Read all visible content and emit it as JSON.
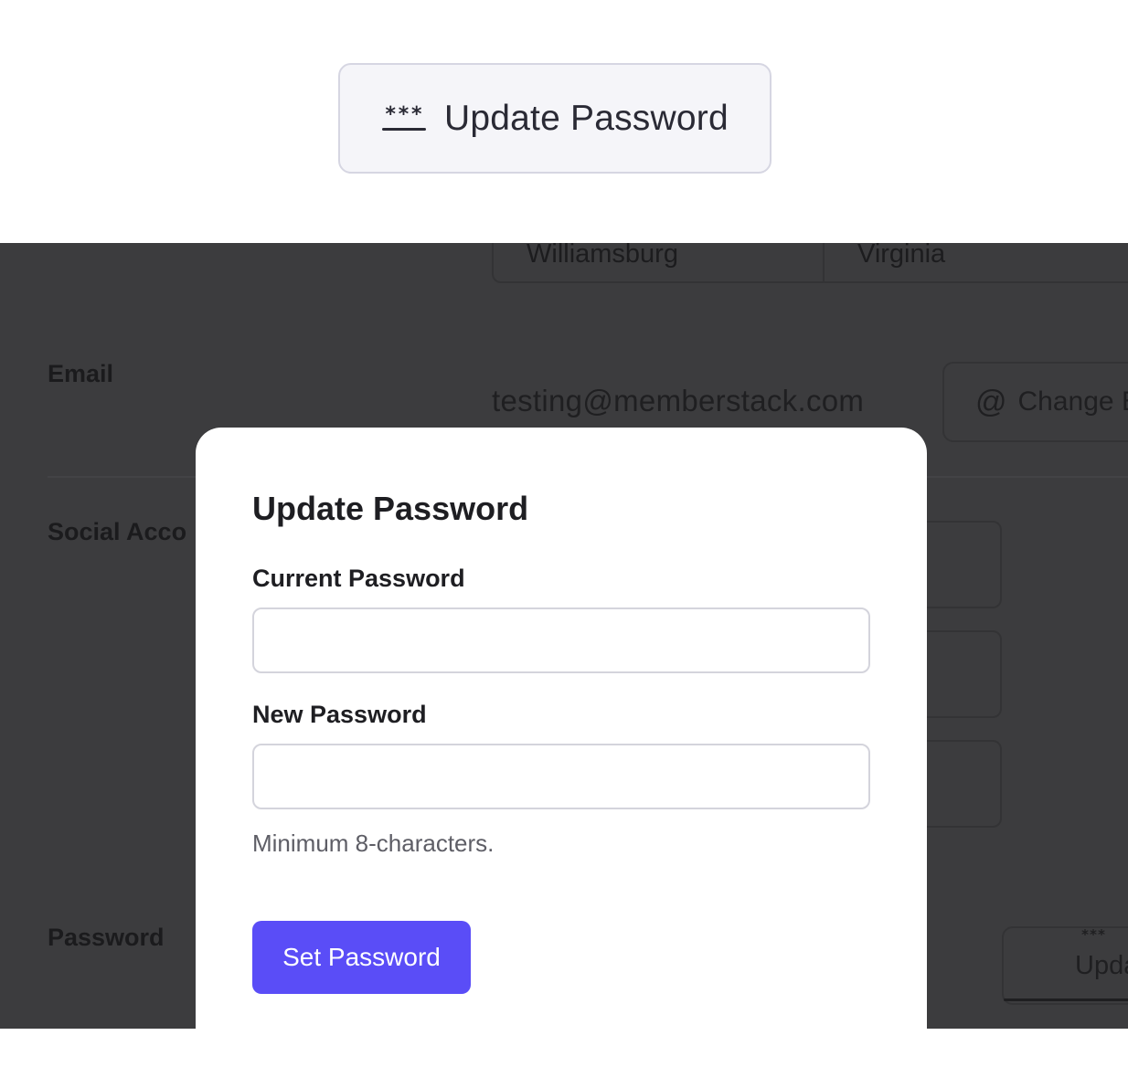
{
  "top_button": {
    "label": "Update Password",
    "icon": "password-icon"
  },
  "background": {
    "address": {
      "city": "Williamsburg",
      "state": "Virginia"
    },
    "email": {
      "label": "Email",
      "value": "testing@memberstack.com",
      "change_button_label": "Change E"
    },
    "social": {
      "label": "Social Acco"
    },
    "password": {
      "label": "Password",
      "update_button_label": "Upda"
    }
  },
  "modal": {
    "title": "Update Password",
    "current_password": {
      "label": "Current Password",
      "value": "",
      "placeholder": ""
    },
    "new_password": {
      "label": "New Password",
      "value": "",
      "placeholder": ""
    },
    "hint": "Minimum 8-characters.",
    "submit_label": "Set Password"
  },
  "colors": {
    "primary": "#5a4df7",
    "overlay": "#3c3c3e",
    "modal_bg": "#ffffff"
  }
}
